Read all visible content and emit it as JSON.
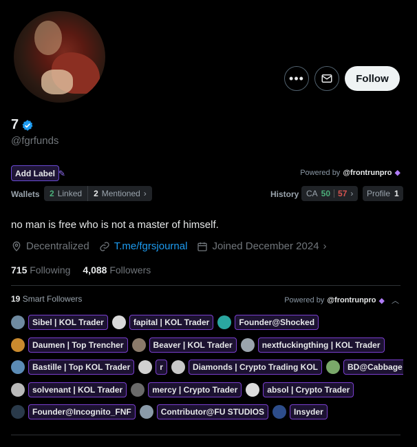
{
  "profile": {
    "name": "7",
    "handle": "@fgrfunds",
    "follow_label": "Follow",
    "bio": "no man is free who is not a master of himself.",
    "location": "Decentralized",
    "link": "T.me/fgrsjournal",
    "joined": "Joined December 2024",
    "following_count": "715",
    "following_label": "Following",
    "followers_count": "4,088",
    "followers_label": "Followers"
  },
  "label_bar": {
    "add_label": "Add Label",
    "powered_by": "Powered by",
    "powered_name": "@frontrunpro"
  },
  "wallets": {
    "label": "Wallets",
    "linked_count": "2",
    "linked_label": "Linked",
    "mentioned_count": "2",
    "mentioned_label": "Mentioned"
  },
  "history": {
    "label": "History",
    "ca_label": "CA",
    "ca_up": "50",
    "ca_down": "57",
    "profile_label": "Profile",
    "profile_count": "1"
  },
  "smart_followers": {
    "count": "19",
    "label": "Smart Followers",
    "powered_by": "Powered by",
    "powered_name": "@frontrunpro",
    "rows": [
      [
        {
          "name": "Sibel | KOL Trader",
          "color": "#6f8aa0"
        },
        {
          "name": "fapital | KOL Trader",
          "color": "#d9d9d9"
        },
        {
          "name": "Founder@Shocked",
          "color": "#2aa6a0"
        }
      ],
      [
        {
          "name": "Daumen | Top Trencher",
          "color": "#c98a2e"
        },
        {
          "name": "Beaver | KOL Trader",
          "color": "#8a7a6a"
        },
        {
          "name": "nextfuckingthing | KOL Trader",
          "color": "#9aa4ad"
        }
      ],
      [
        {
          "name": "Bastille | Top KOL Trader",
          "color": "#5b8bb5"
        },
        {
          "name": "r",
          "color": "#d0d0d0"
        },
        {
          "name": "Diamonds | Crypto Trading KOL",
          "color": "#c8c8c8"
        },
        {
          "name": "BD@Cabbage",
          "color": "#7aa86a"
        }
      ],
      [
        {
          "name": "solvenant | KOL Trader",
          "color": "#b9b9b9"
        },
        {
          "name": "mercy | Crypto Trader",
          "color": "#6a6a6a"
        },
        {
          "name": "absol | Crypto Trader",
          "color": "#dcdcdc"
        }
      ],
      [
        {
          "name": "Founder@Incognito_FNF",
          "color": "#2a3a4a"
        },
        {
          "name": "Contributor@FU STUDIOS",
          "color": "#8a9aa8"
        },
        {
          "name": "Insyder",
          "color": "#2d4d8a"
        }
      ]
    ]
  },
  "colors": {
    "background": "#000000",
    "link": "#1d9bf0",
    "verified": "#1d9bf0",
    "chip_border": "#7b3fd1",
    "green": "#4caf7a",
    "red": "#d4534f"
  }
}
